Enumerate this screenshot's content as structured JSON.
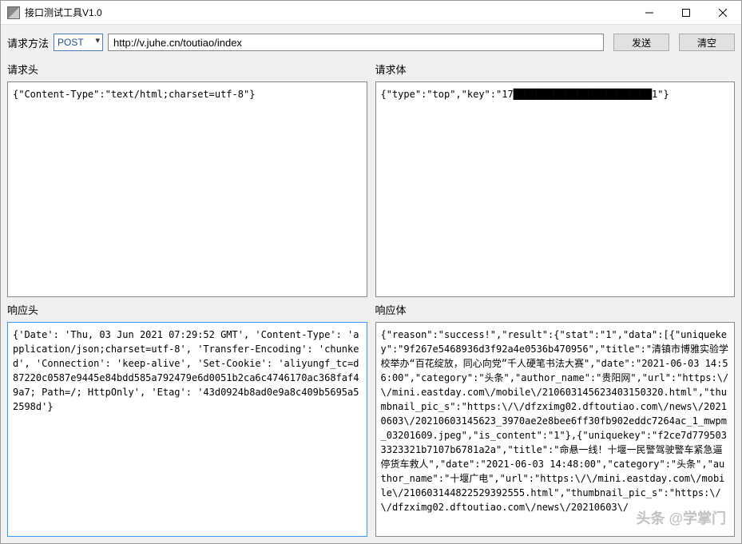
{
  "window": {
    "title": "接口测试工具V1.0"
  },
  "toolbar": {
    "method_label": "请求方法",
    "method_value": "POST",
    "url": "http://v.juhe.cn/toutiao/index",
    "send_label": "发送",
    "clear_label": "清空"
  },
  "labels": {
    "request_header": "请求头",
    "request_body": "请求体",
    "response_header": "响应头",
    "response_body": "响应体"
  },
  "request": {
    "header": "{\"Content-Type\":\"text/html;charset=utf-8\"}",
    "body": "{\"type\":\"top\",\"key\":\"17████████████████████████1\"}"
  },
  "response": {
    "header": "{'Date': 'Thu, 03 Jun 2021 07:29:52 GMT', 'Content-Type': 'application/json;charset=utf-8', 'Transfer-Encoding': 'chunked', 'Connection': 'keep-alive', 'Set-Cookie': 'aliyungf_tc=d87220c0587e9445e84bdd585a792479e6d0051b2ca6c4746170ac368faf49a7; Path=/; HttpOnly', 'Etag': '43d0924b8ad0e9a8c409b5695a52598d'}",
    "body": "{\"reason\":\"success!\",\"result\":{\"stat\":\"1\",\"data\":[{\"uniquekey\":\"9f267e5468936d3f92a4e0536b470956\",\"title\":\"清镇市博雅实验学校举办“百花绽放，同心向党”千人硬笔书法大赛\",\"date\":\"2021-06-03 14:56:00\",\"category\":\"头条\",\"author_name\":\"贵阳网\",\"url\":\"https:\\/\\/mini.eastday.com\\/mobile\\/210603145623403150320.html\",\"thumbnail_pic_s\":\"https:\\/\\/dfzximg02.dftoutiao.com\\/news\\/20210603\\/20210603145623_3970ae2e8bee6ff30fb902eddc7264ac_1_mwpm_03201609.jpeg\",\"is_content\":\"1\"},{\"uniquekey\":\"f2ce7d7795033323321b7107b6781a2a\",\"title\":\"命悬一线！十堰一民警驾驶警车紧急逼停货车救人\",\"date\":\"2021-06-03 14:48:00\",\"category\":\"头条\",\"author_name\":\"十堰广电\",\"url\":\"https:\\/\\/mini.eastday.com\\/mobile\\/210603144822529392555.html\",\"thumbnail_pic_s\":\"https:\\/\\/dfzximg02.dftoutiao.com\\/news\\/20210603\\/"
  },
  "watermark": "头条 @学掌门"
}
